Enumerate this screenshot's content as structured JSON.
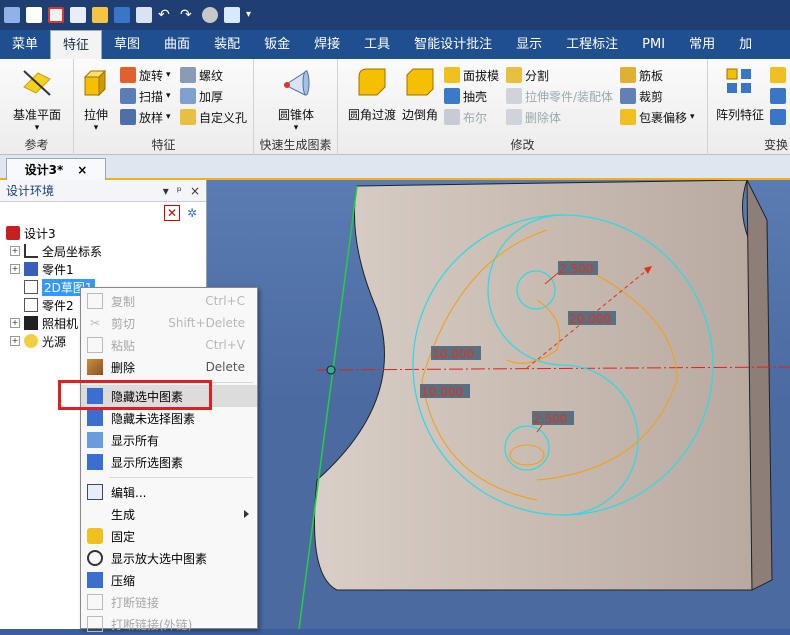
{
  "qat": {
    "icons": [
      "app-logo-icon",
      "new-file-icon",
      "close-file-icon",
      "print-preview-icon",
      "open-folder-icon",
      "save-icon",
      "copy-icon",
      "undo-icon",
      "redo-icon",
      "render-icon",
      "magic-icon",
      "dropdown-icon"
    ]
  },
  "tabs": [
    "菜单",
    "特征",
    "草图",
    "曲面",
    "装配",
    "钣金",
    "焊接",
    "工具",
    "智能设计批注",
    "显示",
    "工程标注",
    "PMI",
    "常用",
    "加"
  ],
  "active_tab": "特征",
  "ribbon": {
    "groups": {
      "reference": "参考",
      "feature": "特征",
      "quick": "快速生成图素",
      "modify": "修改",
      "transform": "变换"
    },
    "base_plane": "基准平面",
    "extrude": "拉伸",
    "rotate": "旋转",
    "sweep": "扫描",
    "loft": "放样",
    "thread": "螺纹",
    "thicken": "加厚",
    "custom_hole": "自定义孔",
    "cone": "圆锥体",
    "fillet": "圆角过渡",
    "chamfer": "边倒角",
    "face_draft": "面拔模",
    "shell": "抽壳",
    "boolean": "布尔",
    "split": "分割",
    "stretch_part": "拉伸零件/装配体",
    "delete_body": "删除体",
    "rib": "筋板",
    "trim": "裁剪",
    "wrap_offset": "包裹偏移",
    "array_feature": "阵列特征"
  },
  "document": {
    "tab_label": "设计3*",
    "close": "×"
  },
  "panel": {
    "title": "设计环境",
    "pin": "ᵖ",
    "close": "×",
    "tree": [
      {
        "label": "设计3",
        "level": 0
      },
      {
        "label": "全局坐标系",
        "level": 1
      },
      {
        "label": "零件1",
        "level": 1
      },
      {
        "label": "2D草图1",
        "level": 1,
        "selected": true
      },
      {
        "label": "零件2",
        "level": 1
      },
      {
        "label": "照相机",
        "level": 1
      },
      {
        "label": "光源",
        "level": 1
      }
    ]
  },
  "dimensions": [
    "2.500",
    "20.000",
    "10.000",
    "10.000",
    "2.500"
  ],
  "menu": {
    "items": [
      {
        "label": "复制",
        "key": "Ctrl+C",
        "disabled": true,
        "icon": "copy-icon"
      },
      {
        "label": "剪切",
        "key": "Shift+Delete",
        "disabled": true,
        "icon": "cut-icon"
      },
      {
        "label": "粘贴",
        "key": "Ctrl+V",
        "disabled": true,
        "icon": "paste-icon"
      },
      {
        "label": "删除",
        "key": "Delete",
        "disabled": false,
        "icon": "delete-icon"
      },
      {
        "label": "隐藏选中图素",
        "key": "",
        "disabled": false,
        "icon": "hide-selected-icon"
      },
      {
        "label": "隐藏未选择图素",
        "key": "",
        "disabled": false,
        "icon": "hide-unselected-icon"
      },
      {
        "label": "显示所有",
        "key": "",
        "disabled": false,
        "icon": "show-all-icon"
      },
      {
        "label": "显示所选图素",
        "key": "",
        "disabled": false,
        "icon": "show-selected-icon"
      },
      {
        "label": "编辑...",
        "key": "",
        "disabled": false,
        "icon": "edit-icon"
      },
      {
        "label": "生成",
        "key": "",
        "disabled": false,
        "icon": ""
      },
      {
        "label": "固定",
        "key": "",
        "disabled": false,
        "icon": "fix-icon"
      },
      {
        "label": "显示放大选中图素",
        "key": "",
        "disabled": false,
        "icon": "zoom-selected-icon"
      },
      {
        "label": "压缩",
        "key": "",
        "disabled": false,
        "icon": "suppress-icon"
      },
      {
        "label": "打断链接",
        "key": "",
        "disabled": true,
        "icon": "break-link-icon"
      },
      {
        "label": "打断链接(外链)",
        "key": "",
        "disabled": true,
        "icon": "break-external-link-icon"
      }
    ]
  },
  "colors": {
    "title_bar": "#1f3f73",
    "tab_bar": "#1f4f8f",
    "highlight_box": "#e02020",
    "sketch_cyan": "#34d8e0",
    "sketch_orange": "#f0a020",
    "dimension_red": "#e03020",
    "viewport": "#4a6aa0"
  }
}
